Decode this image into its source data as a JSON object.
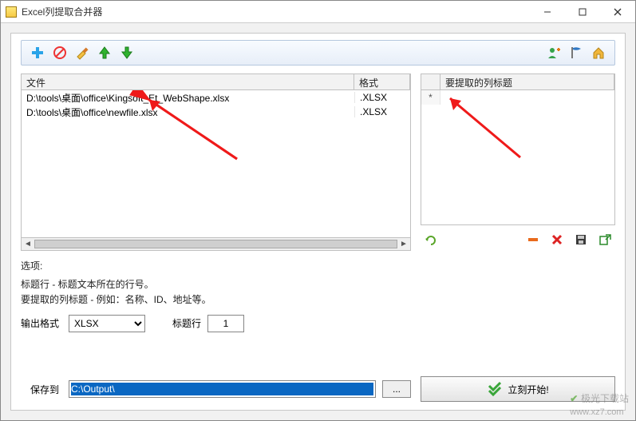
{
  "window": {
    "title": "Excel列提取合并器",
    "min_tip": "最小化",
    "max_tip": "最大化",
    "close_tip": "关闭"
  },
  "toolbar": {
    "icons": {
      "add": "add-icon",
      "forbid": "forbid-icon",
      "clear": "brush-icon",
      "up": "arrow-up-icon",
      "down": "arrow-down-icon",
      "user": "user-add-icon",
      "flag": "flag-icon",
      "home": "home-icon"
    }
  },
  "file_grid": {
    "headers": {
      "file": "文件",
      "format": "格式"
    },
    "rows": [
      {
        "file": "D:\\tools\\桌面\\office\\Kingsoft_Et_WebShape.xlsx",
        "format": ".XLSX"
      },
      {
        "file": "D:\\tools\\桌面\\office\\newfile.xlsx",
        "format": ".XLSX"
      }
    ]
  },
  "col_grid": {
    "header": "要提取的列标题",
    "new_row_marker": "*"
  },
  "right_actions": {
    "redo": "redo-icon",
    "remove": "remove-icon",
    "delete": "delete-icon",
    "save": "save-icon",
    "export": "export-icon"
  },
  "options": {
    "title": "选项:",
    "line1": "标题行 - 标题文本所在的行号。",
    "line2": "要提取的列标题 - 例如：名称、ID、地址等。",
    "output_format_label": "输出格式",
    "output_format_value": "XLSX",
    "title_row_label": "标题行",
    "title_row_value": "1",
    "save_to_label": "保存到",
    "save_to_value": "C:\\Output\\",
    "browse": "..."
  },
  "start": {
    "label": "立刻开始!"
  },
  "watermark": {
    "site_name": "极光下载站",
    "url": "www.xz7.com"
  }
}
